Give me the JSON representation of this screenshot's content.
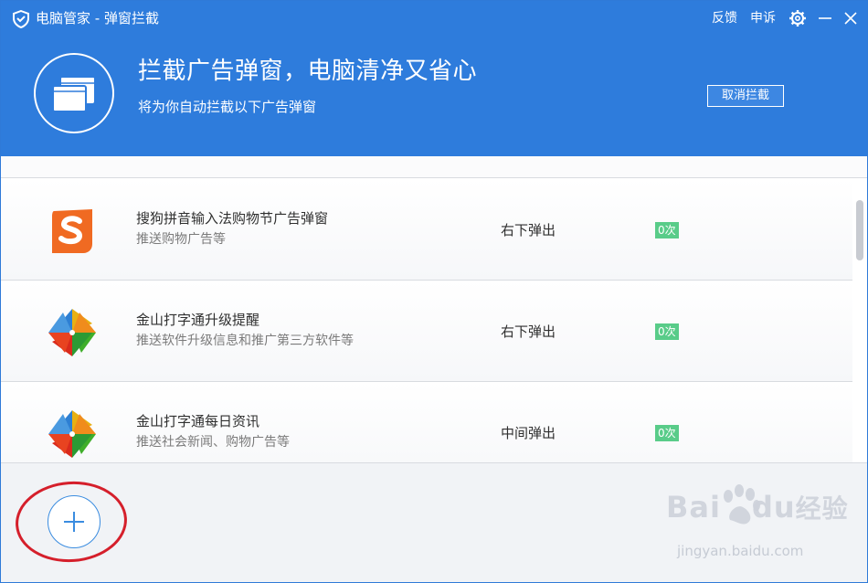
{
  "window": {
    "title": "电脑管家 - 弹窗拦截",
    "feedback": "反馈",
    "appeal": "申诉"
  },
  "hero": {
    "title": "拦截广告弹窗，电脑清净又省心",
    "subtitle": "将为你自动拦截以下广告弹窗",
    "cancel_label": "取消拦截"
  },
  "list": {
    "items": [
      {
        "icon": "sogou-s-logo-icon",
        "title": "搜狗拼音输入法购物节广告弹窗",
        "desc": "推送购物广告等",
        "position": "右下弹出",
        "count": "0次"
      },
      {
        "icon": "kingsoft-typing-pinwheel-icon",
        "title": "金山打字通升级提醒",
        "desc": "推送软件升级信息和推广第三方软件等",
        "position": "右下弹出",
        "count": "0次"
      },
      {
        "icon": "kingsoft-typing-pinwheel-icon",
        "title": "金山打字通每日资讯",
        "desc": "推送社会新闻、购物广告等",
        "position": "中间弹出",
        "count": "0次"
      }
    ]
  },
  "footer": {
    "add_icon": "plus-icon"
  },
  "watermark": {
    "brand_left": "Bai",
    "brand_right": "du",
    "brand_cn": "经验",
    "url": "jingyan.baidu.com"
  },
  "colors": {
    "header_blue": "#2e7cdc",
    "count_green": "#59cc89",
    "annotation_red": "#d51f2b",
    "sogou_orange": "#f06a22"
  }
}
